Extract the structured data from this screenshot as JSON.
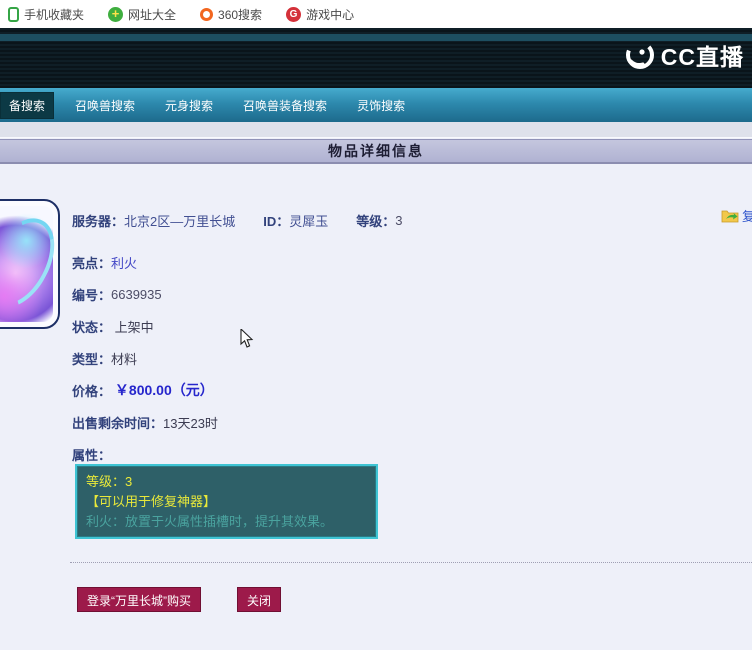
{
  "bookmarks": {
    "items": [
      {
        "label": "手机收藏夹",
        "icon": "phone-icon"
      },
      {
        "label": "网址大全",
        "icon": "plus-circle-icon"
      },
      {
        "label": "360搜索",
        "icon": "360-search-icon"
      },
      {
        "label": "游戏中心",
        "icon": "game-center-icon"
      }
    ]
  },
  "header": {
    "logo_text": "CC直播"
  },
  "nav": {
    "tabs": [
      {
        "label": "备搜索",
        "selected": true
      },
      {
        "label": "召唤兽搜索",
        "selected": false
      },
      {
        "label": "元身搜索",
        "selected": false
      },
      {
        "label": "召唤兽装备搜索",
        "selected": false
      },
      {
        "label": "灵饰搜索",
        "selected": false
      }
    ]
  },
  "title_bar": {
    "title": "物品详细信息"
  },
  "item": {
    "server_label": "服务器：",
    "server": "北京2区—万里长城",
    "id_label": "ID：",
    "id": "灵犀玉",
    "level_label": "等级：",
    "level": "3",
    "copy_link_partial": "复",
    "rows": [
      {
        "label": "亮点：",
        "value": "利火"
      },
      {
        "label": "编号：",
        "value": "6639935"
      },
      {
        "label": "状态：",
        "value": " 上架中"
      },
      {
        "label": "类型：",
        "value": "材料"
      },
      {
        "label": "价格：",
        "value": " ￥800.00（元）"
      },
      {
        "label": "出售剩余时间：",
        "value": "13天23时"
      },
      {
        "label": "属性：",
        "value": ""
      }
    ],
    "attributes": {
      "lines": [
        {
          "text": "等级：3",
          "color": "yellow"
        },
        {
          "text": "【可以用于修复神器】",
          "color": "yellow"
        },
        {
          "text": "利火：放置于火属性插槽时，提升其效果。",
          "color": "teal"
        }
      ]
    }
  },
  "actions": {
    "login_buy": "登录“万里长城”购买",
    "close": "关闭"
  },
  "colors": {
    "nav_teal_top": "#46abce",
    "nav_teal_bottom": "#1d6a8c",
    "title_bar_bg": "#b0b2d2",
    "content_bg": "#eef0f9",
    "label_navy": "#32427c",
    "price_blue": "#2626cc",
    "attr_box_bg": "#2e6068",
    "attr_box_border": "#3fc4d4",
    "attr_yellow": "#e9e93a",
    "attr_teal": "#4aa39f",
    "button_red": "#9d1a4a"
  }
}
